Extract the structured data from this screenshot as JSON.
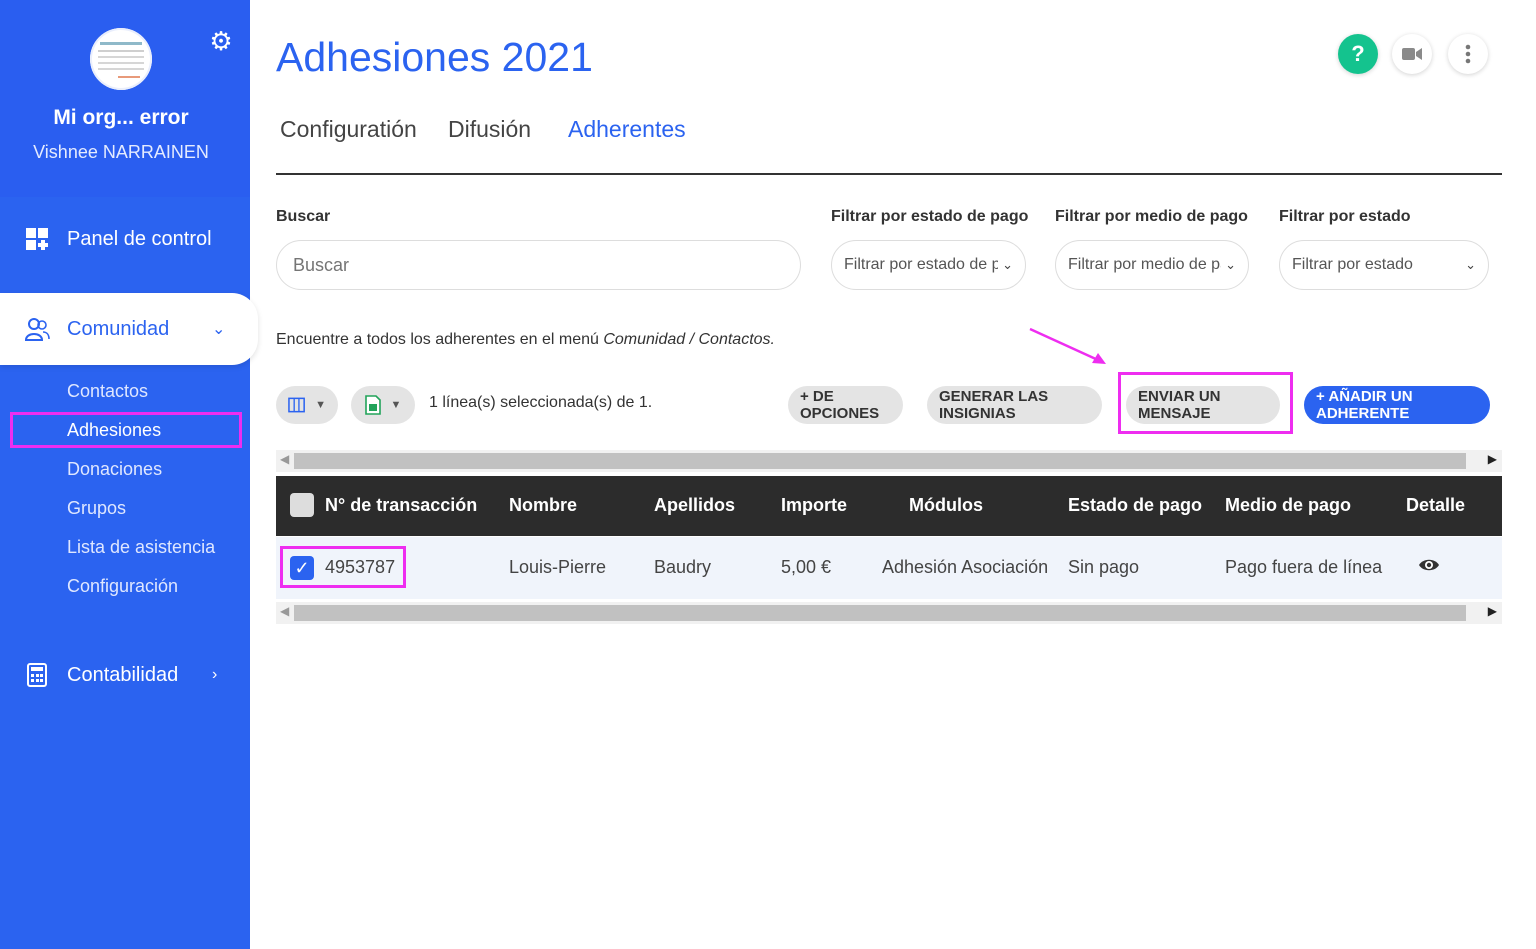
{
  "sidebar": {
    "org_name": "Mi org... error",
    "user_name": "Vishnee NARRAINEN",
    "settings_icon": "gear-icon",
    "items": [
      {
        "label": "Panel de control",
        "icon": "dashboard-icon"
      },
      {
        "label": "Comunidad",
        "icon": "people-icon"
      },
      {
        "label": "Contabilidad",
        "icon": "calculator-icon"
      }
    ],
    "sub_items": [
      "Contactos",
      "Adhesiones",
      "Donaciones",
      "Grupos",
      "Lista de asistencia",
      "Configuración"
    ]
  },
  "header": {
    "title": "Adhesiones 2021",
    "help_label": "?"
  },
  "tabs": [
    "Configuratión",
    "Difusión",
    "Adherentes"
  ],
  "filters": {
    "search_label": "Buscar",
    "search_placeholder": "Buscar",
    "payment_status_label": "Filtrar por estado de pago",
    "payment_status_value": "Filtrar por estado de pago",
    "payment_method_label": "Filtrar por medio de pago",
    "payment_method_value": "Filtrar por medio de pago",
    "status_label": "Filtrar por estado",
    "status_value": "Filtrar por estado"
  },
  "info": {
    "prefix": "Encuentre a todos los adherentes en el menú ",
    "path": "Comunidad / Contactos."
  },
  "toolbar": {
    "selection_count": "1 línea(s) seleccionada(s) de 1.",
    "more_options": "+ DE OPCIONES",
    "generate_badges": "GENERAR LAS INSIGNIAS",
    "send_message": "ENVIAR UN MENSAJE",
    "add_member": "+ AÑADIR UN ADHERENTE"
  },
  "table": {
    "columns": [
      "N° de transacción",
      "Nombre",
      "Apellidos",
      "Importe",
      "Módulos",
      "Estado de pago",
      "Medio de pago",
      "Detalle"
    ],
    "rows": [
      [
        "4953787",
        "Louis-Pierre",
        "Baudry",
        "5,00 €",
        "Adhesión Asociación",
        "Sin pago",
        "Pago fuera de línea"
      ]
    ]
  },
  "colors": {
    "accent": "#2b63f0",
    "highlight": "#ee2df0",
    "help_green": "#14c38e"
  }
}
